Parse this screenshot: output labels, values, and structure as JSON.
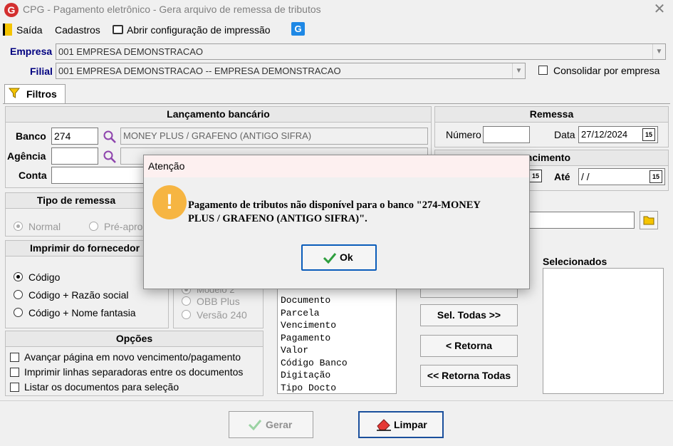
{
  "window": {
    "title": "CPG - Pagamento eletrônico - Gera arquivo de remessa de tributos",
    "app_icon_glyph": "G",
    "close_glyph": "✕"
  },
  "menu": {
    "exit_label": "Saída",
    "cadastros_label": "Cadastros",
    "print_config_label": "Abrir configuração de impressão",
    "blue_g_glyph": "G"
  },
  "empresa": {
    "label": "Empresa",
    "value": "001 EMPRESA DEMONSTRACAO"
  },
  "filial": {
    "label": "Filial",
    "value": "001 EMPRESA DEMONSTRACAO -- EMPRESA DEMONSTRACAO",
    "consolidar_label": "Consolidar por empresa",
    "consolidar_checked": false
  },
  "tab": {
    "label": "Filtros"
  },
  "lancamento": {
    "header": "Lançamento bancário",
    "banco_label": "Banco",
    "banco_value": "274",
    "banco_desc": "MONEY PLUS / GRAFENO (ANTIGO SIFRA)",
    "agencia_label": "Agência",
    "agencia_value": "",
    "conta_label": "Conta",
    "conta_value": ""
  },
  "remessa": {
    "header": "Remessa",
    "numero_label": "Número",
    "numero_value": "",
    "data_label": "Data",
    "data_value": "27/12/2024",
    "cal_glyph": "15"
  },
  "vencimento": {
    "header_partial": "encimento",
    "ate_label": "Até",
    "ate_value": " / /",
    "cal_glyph": "15"
  },
  "tipo_remessa": {
    "header": "Tipo de remessa",
    "options": [
      "Normal",
      "Pré-apro"
    ],
    "selected": 0
  },
  "imprimir_fornecedor": {
    "header": "Imprimir do fornecedor",
    "options": [
      "Código",
      "Código + Razão social",
      "Código + Nome fantasia"
    ],
    "selected": 0
  },
  "versao": {
    "options": [
      "Modelo 2",
      "OBB Plus",
      "Versão 240"
    ]
  },
  "opcoes": {
    "header": "Opções",
    "items": [
      "Avançar página em novo vencimento/pagamento",
      "Imprimir linhas separadoras entre os documentos",
      "Listar os documentos para seleção"
    ]
  },
  "fields_list": {
    "items": [
      "Documento",
      "Parcela",
      "Vencimento",
      "Pagamento",
      "Valor",
      "Código Banco",
      "Digitação",
      "Tipo Docto"
    ]
  },
  "selection_buttons": {
    "sel_todas": "Sel. Todas >>",
    "retorna": "< Retorna",
    "retorna_todas": "<< Retorna Todas"
  },
  "selecionados": {
    "header": "Selecionados"
  },
  "footer": {
    "gerar_label": "Gerar",
    "limpar_label": "Limpar"
  },
  "dialog": {
    "title": "Atenção",
    "icon_glyph": "!",
    "message_line1": "Pagamento de tributos não disponível para o banco \"274-MONEY",
    "message_line2": "PLUS / GRAFENO (ANTIGO SIFRA)\".",
    "ok_label": "Ok"
  },
  "colors": {
    "label_blue": "#000080",
    "warning": "#f6b542",
    "ok_border": "#0a5cba",
    "check_green": "#2e9e3e"
  }
}
